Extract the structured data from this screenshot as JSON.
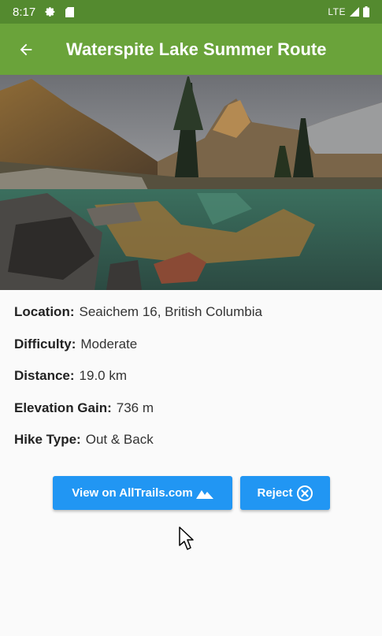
{
  "status_bar": {
    "time": "8:17",
    "network": "LTE",
    "icons": [
      "gear-icon",
      "sd-card-icon",
      "signal-icon",
      "battery-icon"
    ]
  },
  "app_bar": {
    "title": "Waterspite Lake Summer Route",
    "back_icon": "arrow-left-icon"
  },
  "hero_image": {
    "subject": "mountain-lake-photo"
  },
  "details": [
    {
      "label": "Location:",
      "value": "Seaichem 16, British Columbia"
    },
    {
      "label": "Difficulty:",
      "value": "Moderate"
    },
    {
      "label": "Distance:",
      "value": "19.0 km"
    },
    {
      "label": "Elevation Gain:",
      "value": "736 m"
    },
    {
      "label": "Hike Type:",
      "value": "Out & Back"
    }
  ],
  "actions": {
    "view_label": "View on AllTrails.com",
    "view_icon": "mountain-icon",
    "reject_label": "Reject",
    "reject_icon": "close-circle-icon"
  },
  "colors": {
    "status_bar": "#548a2f",
    "app_bar": "#6aa33a",
    "button": "#2196f3",
    "background": "#fafafa"
  }
}
